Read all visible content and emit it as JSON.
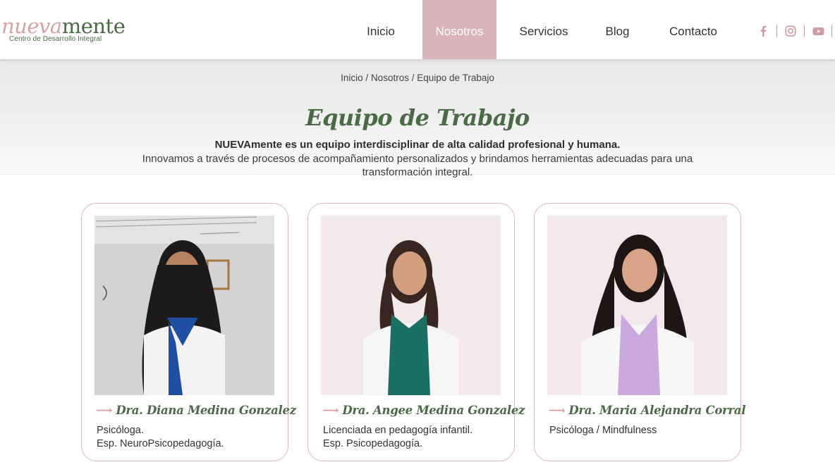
{
  "header": {
    "logo_part1": "nueva",
    "logo_part2": "mente",
    "logo_sub": "Centro de Desarrollo Integral",
    "nav": [
      {
        "label": "Inicio"
      },
      {
        "label": "Nosotros"
      },
      {
        "label": "Servicios"
      },
      {
        "label": "Blog"
      },
      {
        "label": "Contacto"
      }
    ],
    "active_nav": "Nosotros",
    "social": [
      "facebook-icon",
      "instagram-icon",
      "youtube-icon"
    ]
  },
  "breadcrumb": {
    "home": "Inicio",
    "sep": "/",
    "section": "Nosotros",
    "current": "Equipo de Trabajo"
  },
  "hero": {
    "title": "Equipo de Trabajo",
    "lead": "NUEVAmente es un equipo interdisciplinar de alta calidad profesional y humana.",
    "description": "Innovamos a través de procesos de acompañamiento personalizados y brindamos herramientas adecuadas para una transformación integral."
  },
  "team": [
    {
      "name": "Dra. Diana Medina Gonzalez",
      "role_line1": "Psicóloga.",
      "role_line2": "Esp. NeuroPsicopedagogía."
    },
    {
      "name": "Dra. Angee Medina Gonzalez",
      "role_line1": "Licenciada en pedagogía infantil.",
      "role_line2": "Esp. Psicopedagogía."
    },
    {
      "name": "Dra. Maria Alejandra Corral",
      "role_line1": "Psicóloga / Mindfulness",
      "role_line2": ""
    }
  ],
  "colors": {
    "brand_green": "#4a6b45",
    "brand_pink": "#d4a3a9",
    "nav_active_bg": "#d9b5b8",
    "card_border": "#e0b7bc"
  }
}
